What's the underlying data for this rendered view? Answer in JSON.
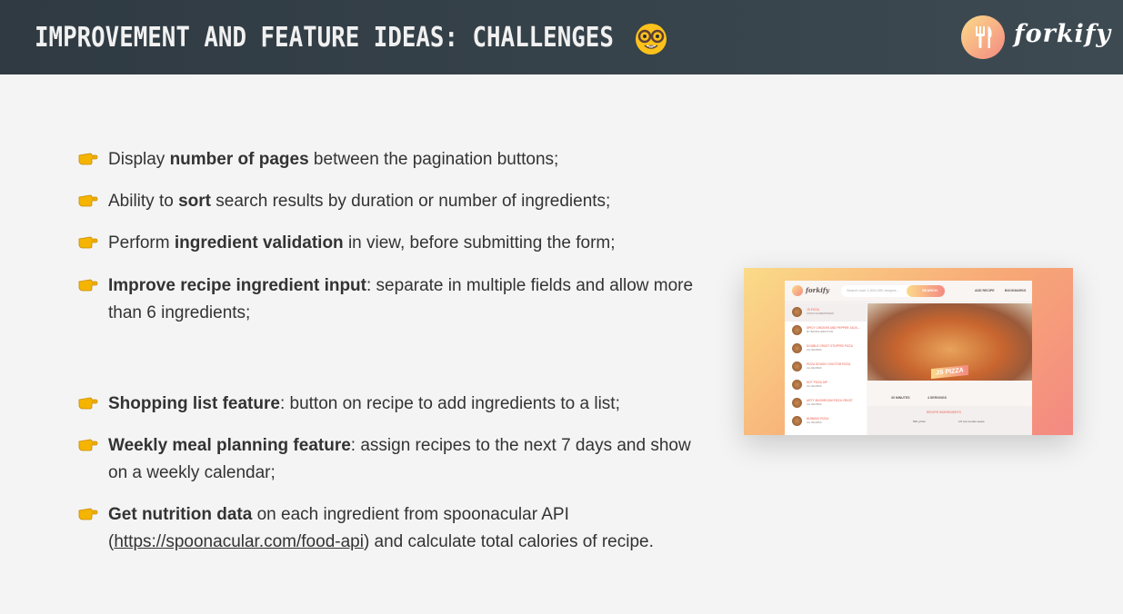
{
  "header": {
    "title": "IMPROVEMENT AND FEATURE IDEAS: CHALLENGES",
    "emoji_icon": "nerd-face-icon",
    "brand": "forkify",
    "colors": {
      "header_bg": "#2f3a42",
      "accent_start": "#fbdb89",
      "accent_end": "#f48982"
    }
  },
  "items": [
    {
      "parts": [
        {
          "t": "Display "
        },
        {
          "t": "number of pages",
          "b": true
        },
        {
          "t": " between the pagination buttons;"
        }
      ]
    },
    {
      "parts": [
        {
          "t": "Ability to "
        },
        {
          "t": "sort",
          "b": true
        },
        {
          "t": " search results by duration or number of ingredients;"
        }
      ]
    },
    {
      "parts": [
        {
          "t": "Perform "
        },
        {
          "t": "ingredient validation",
          "b": true
        },
        {
          "t": " in view, before submitting the form;"
        }
      ]
    },
    {
      "parts": [
        {
          "t": "Improve recipe ingredient input",
          "b": true
        },
        {
          "t": ": separate in multiple fields and allow more than 6 ingredients;"
        }
      ]
    },
    {
      "parts": [
        {
          "t": "Shopping list feature",
          "b": true
        },
        {
          "t": ": button on recipe to add ingredients to a list;"
        }
      ]
    },
    {
      "parts": [
        {
          "t": "Weekly meal planning feature",
          "b": true
        },
        {
          "t": ": assign recipes to the next 7 days and show on a weekly calendar;"
        }
      ]
    },
    {
      "parts": [
        {
          "t": "Get nutrition data",
          "b": true
        },
        {
          "t": " on each ingredient from spoonacular API ("
        },
        {
          "t": "https://spoonacular.com/food-api",
          "u": true
        },
        {
          "t": ") and calculate total calories of recipe."
        }
      ]
    }
  ],
  "screenshot": {
    "brand": "forkify",
    "search_placeholder": "Search over 1,000,000 recipes...",
    "search_button": "SEARCH",
    "nav": [
      "ADD RECIPE",
      "BOOKMARKS"
    ],
    "results": [
      {
        "title": "JS PIZZA",
        "publisher": "JONAS SCHMEDTMANN"
      },
      {
        "title": "SPICY CHICKEN AND PEPPER JACK...",
        "publisher": "MY BAKING ADDICTION"
      },
      {
        "title": "DOUBLE CRUST STUFFED PIZZA",
        "publisher": "ALL RECIPES"
      },
      {
        "title": "PIZZA DOUGH I DOCTOR PIZZA",
        "publisher": "ALL RECIPES"
      },
      {
        "title": "HOT PIZZA DIP",
        "publisher": "ALL RECIPES"
      },
      {
        "title": "ARTY MUSHROOM PIZZA CRUST",
        "publisher": "ALL RECIPES"
      },
      {
        "title": "HUMMUS PIZZA",
        "publisher": "ALL RECIPES"
      }
    ],
    "recipe_title": "JS PIZZA",
    "meta": [
      "30 MINUTES",
      "4 SERVINGS"
    ],
    "ingredients_title": "RECIPE INGREDIENTS",
    "ingredients": [
      "500 g flour",
      "1/2 cup tomato sauce"
    ]
  }
}
